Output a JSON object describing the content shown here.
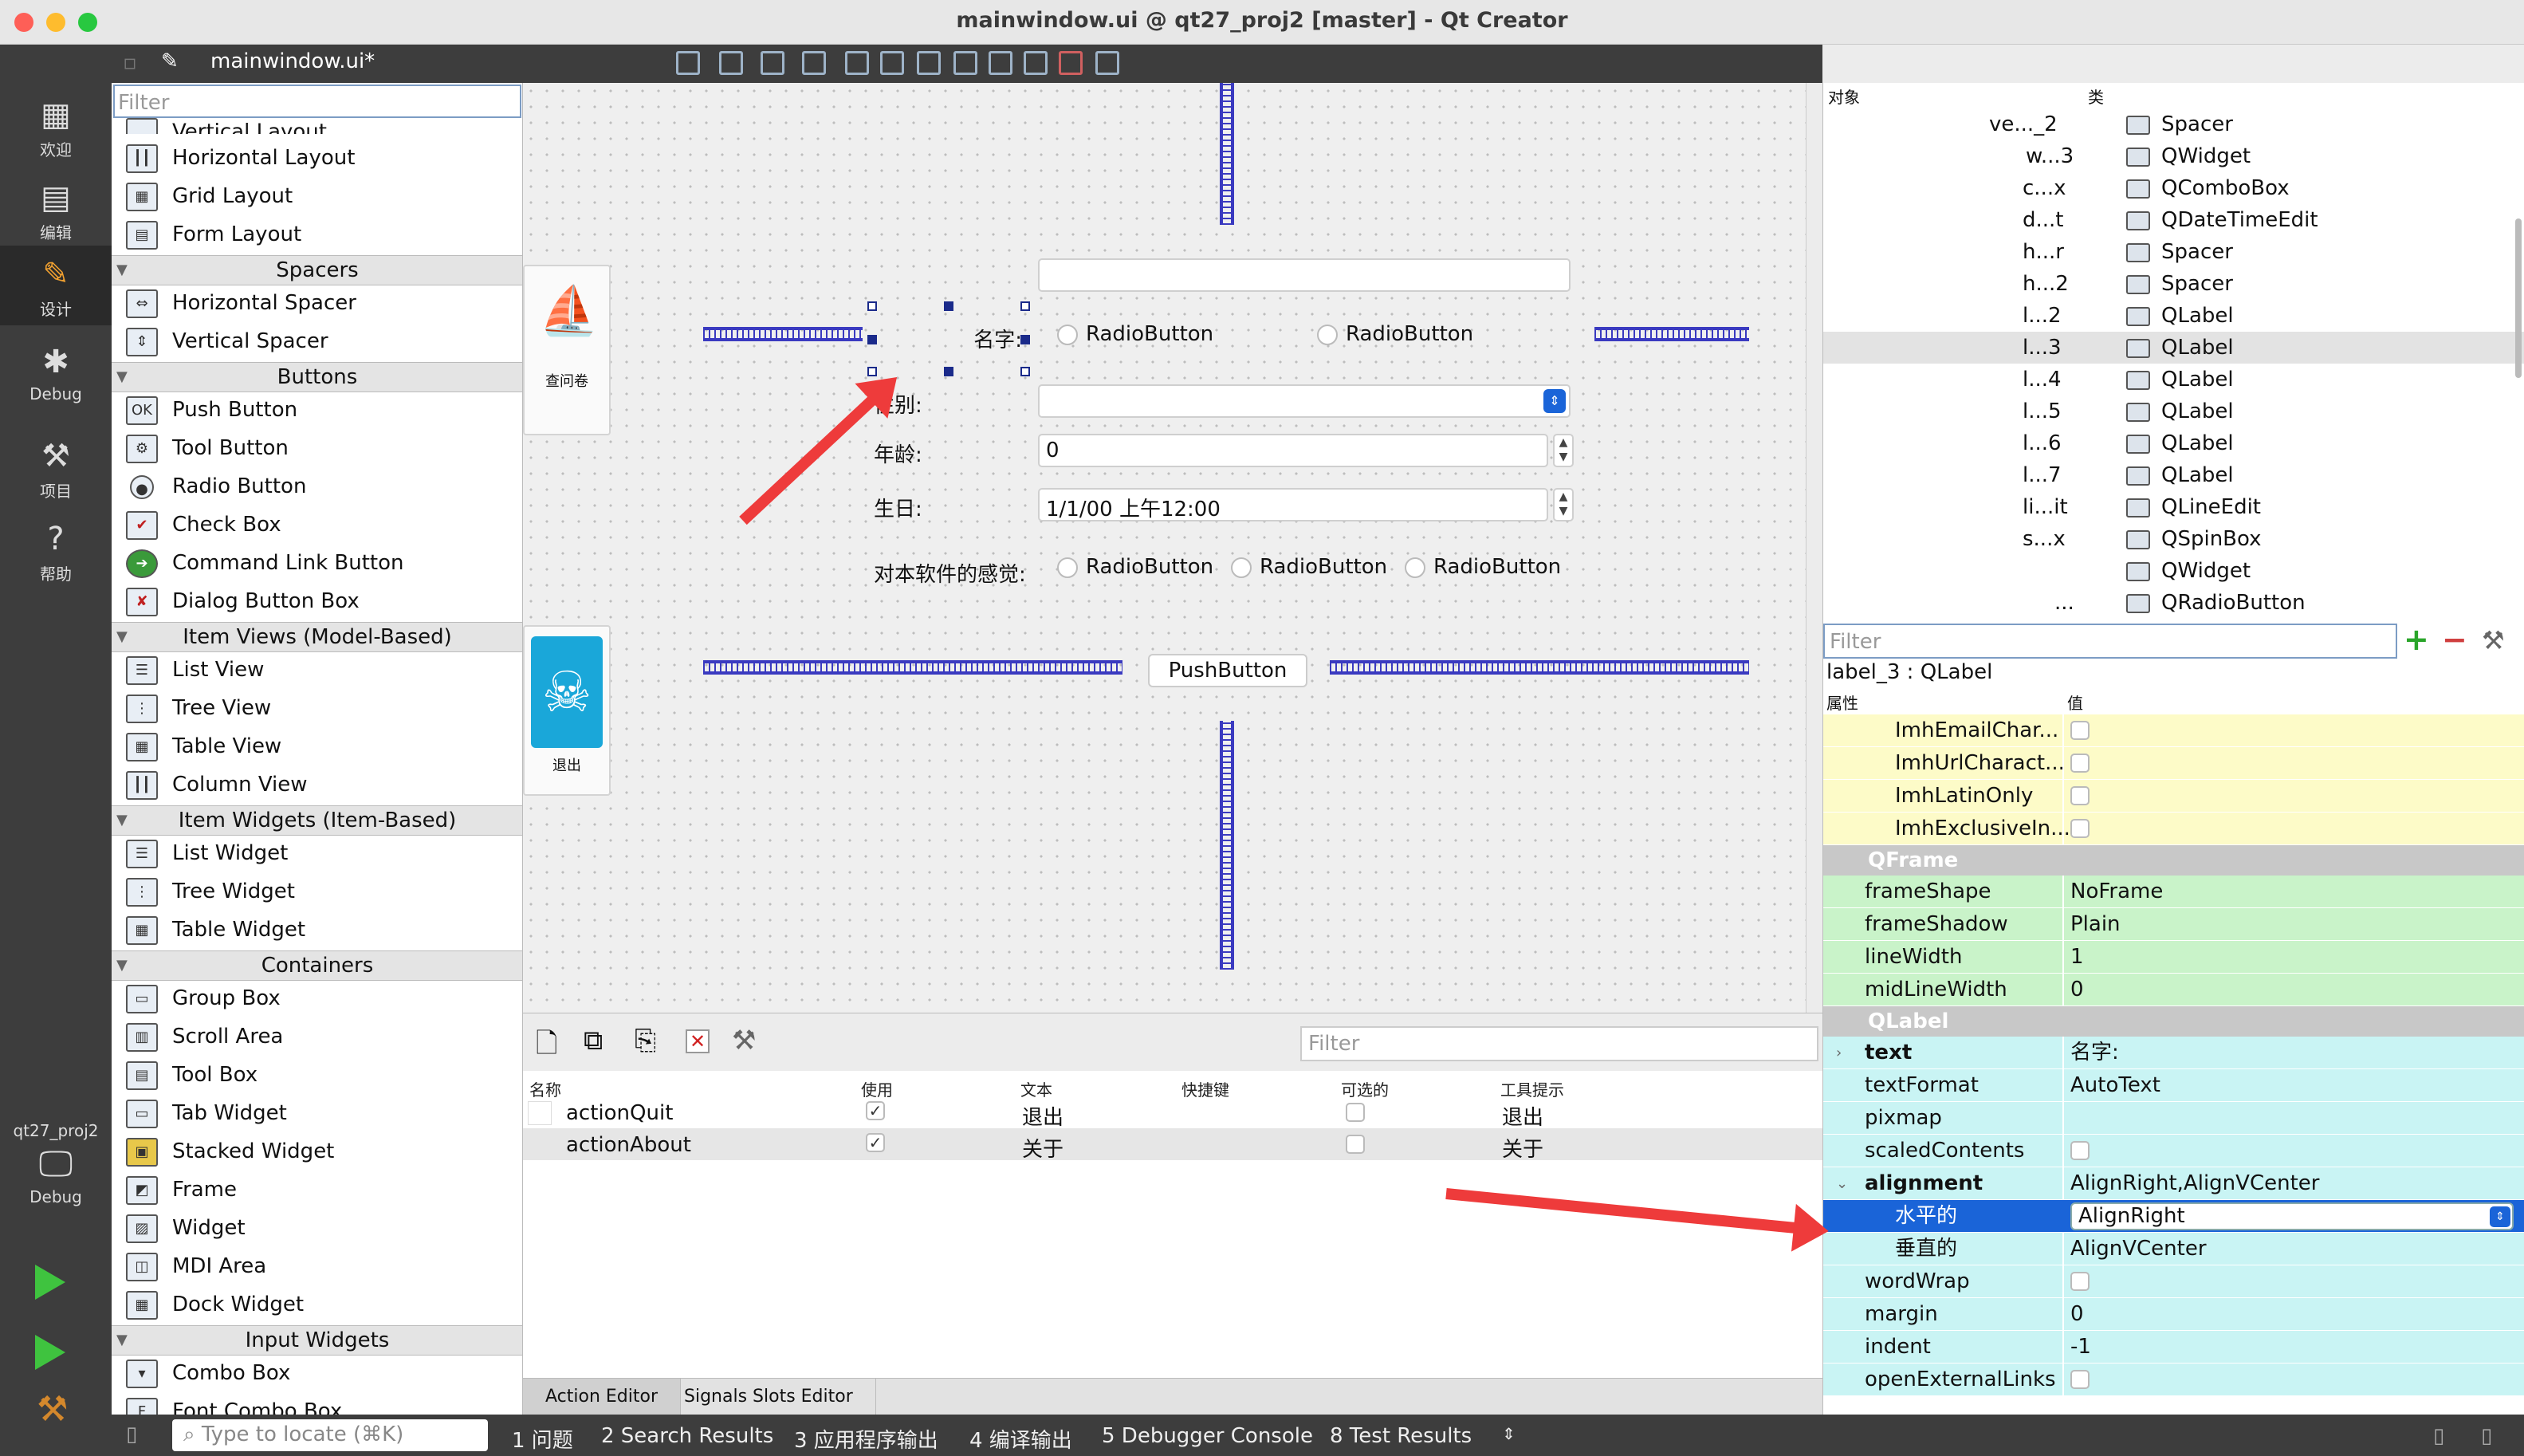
{
  "window": {
    "title": "mainwindow.ui @ qt27_proj2 [master] - Qt Creator"
  },
  "modes": [
    {
      "label": "欢迎",
      "icon": "grid-icon"
    },
    {
      "label": "编辑",
      "icon": "edit-icon"
    },
    {
      "label": "设计",
      "icon": "pencil-icon"
    },
    {
      "label": "Debug",
      "icon": "bug-icon"
    },
    {
      "label": "项目",
      "icon": "wrench-icon"
    },
    {
      "label": "帮助",
      "icon": "help-icon"
    }
  ],
  "kit": {
    "project": "qt27_proj2",
    "mode": "Debug"
  },
  "open_file": "mainwindow.ui*",
  "widgetbox": {
    "filter_placeholder": "Filter",
    "items": [
      "Vertical Layout",
      "Horizontal Layout",
      "Grid Layout",
      "Form Layout",
      "Horizontal Spacer",
      "Vertical Spacer",
      "Push Button",
      "Tool Button",
      "Radio Button",
      "Check Box",
      "Command Link Button",
      "Dialog Button Box",
      "List View",
      "Tree View",
      "Table View",
      "Column View",
      "List Widget",
      "Tree Widget",
      "Table Widget",
      "Group Box",
      "Scroll Area",
      "Tool Box",
      "Tab Widget",
      "Stacked Widget",
      "Frame",
      "Widget",
      "MDI Area",
      "Dock Widget",
      "Combo Box",
      "Font Combo Box"
    ],
    "categories": [
      "Spacers",
      "Buttons",
      "Item Views (Model-Based)",
      "Item Widgets (Item-Based)",
      "Containers",
      "Input Widgets"
    ]
  },
  "form": {
    "name_label": "名字:",
    "gender_label": "性别:",
    "age_label": "年龄:",
    "age_value": "0",
    "birthday_label": "生日:",
    "birthday_value": "1/1/00 上午12:00",
    "feeling_label": "对本软件的感觉:",
    "radio": "RadioButton",
    "push": "PushButton",
    "mdi1": "查问卷",
    "mdi2": "退出"
  },
  "actions": {
    "filter_placeholder": "Filter",
    "headers": [
      "名称",
      "使用",
      "文本",
      "快捷键",
      "可选的",
      "工具提示"
    ],
    "rows": [
      {
        "name": "actionQuit",
        "used": "✓",
        "text": "退出",
        "tooltip": "退出"
      },
      {
        "name": "actionAbout",
        "used": "✓",
        "text": "关于",
        "tooltip": "关于"
      }
    ],
    "tabs": [
      "Action Editor",
      "Signals  Slots Editor"
    ]
  },
  "object_inspector": {
    "headers": [
      "对象",
      "类"
    ],
    "rows": [
      {
        "name": "ve..._2",
        "cls": "Spacer"
      },
      {
        "name": "w...3",
        "cls": "QWidget"
      },
      {
        "name": "c...x",
        "cls": "QComboBox"
      },
      {
        "name": "d...t",
        "cls": "QDateTimeEdit"
      },
      {
        "name": "h...r",
        "cls": "Spacer"
      },
      {
        "name": "h...2",
        "cls": "Spacer"
      },
      {
        "name": "l...2",
        "cls": "QLabel"
      },
      {
        "name": "l...3",
        "cls": "QLabel"
      },
      {
        "name": "l...4",
        "cls": "QLabel"
      },
      {
        "name": "l...5",
        "cls": "QLabel"
      },
      {
        "name": "l...6",
        "cls": "QLabel"
      },
      {
        "name": "l...7",
        "cls": "QLabel"
      },
      {
        "name": "li...it",
        "cls": "QLineEdit"
      },
      {
        "name": "s...x",
        "cls": "QSpinBox"
      },
      {
        "name": "",
        "cls": "QWidget"
      },
      {
        "name": "...",
        "cls": "QRadioButton"
      }
    ]
  },
  "property_editor": {
    "filter_placeholder": "Filter",
    "object": "label_3 : QLabel",
    "headers": [
      "属性",
      "值"
    ],
    "rows": [
      {
        "t": "y",
        "n": "ImhEmailChar...",
        "v": ""
      },
      {
        "t": "y",
        "n": "ImhUrlCharact...",
        "v": ""
      },
      {
        "t": "y",
        "n": "ImhLatinOnly",
        "v": ""
      },
      {
        "t": "y",
        "n": "ImhExclusiveIn...",
        "v": ""
      },
      {
        "t": "grp",
        "n": "QFrame"
      },
      {
        "t": "g",
        "n": "frameShape",
        "v": "NoFrame"
      },
      {
        "t": "g",
        "n": "frameShadow",
        "v": "Plain"
      },
      {
        "t": "g",
        "n": "lineWidth",
        "v": "1"
      },
      {
        "t": "g",
        "n": "midLineWidth",
        "v": "0"
      },
      {
        "t": "grp",
        "n": "QLabel"
      },
      {
        "t": "c",
        "n": "text",
        "v": "名字:"
      },
      {
        "t": "c",
        "n": "textFormat",
        "v": "AutoText"
      },
      {
        "t": "c",
        "n": "pixmap",
        "v": ""
      },
      {
        "t": "c",
        "n": "scaledContents",
        "v": ""
      },
      {
        "t": "c",
        "n": "alignment",
        "v": "AlignRight,AlignVCenter"
      },
      {
        "t": "sel",
        "n": "水平的",
        "v": "AlignRight"
      },
      {
        "t": "c",
        "n": "垂直的",
        "v": "AlignVCenter"
      },
      {
        "t": "c",
        "n": "wordWrap",
        "v": ""
      },
      {
        "t": "c",
        "n": "margin",
        "v": "0"
      },
      {
        "t": "c",
        "n": "indent",
        "v": "-1"
      },
      {
        "t": "c",
        "n": "openExternalLinks",
        "v": ""
      }
    ]
  },
  "statusbar": {
    "locate_placeholder": "Type to locate (⌘K)",
    "tabs": [
      "1  问题",
      "2  Search Results",
      "3  应用程序输出",
      "4  编译输出",
      "5  Debugger Console",
      "8  Test Results"
    ]
  },
  "colors": {
    "annotation_arrow": "#ee3b3b",
    "spacer": "#3a3ac0",
    "selection": "#1a64d8"
  }
}
